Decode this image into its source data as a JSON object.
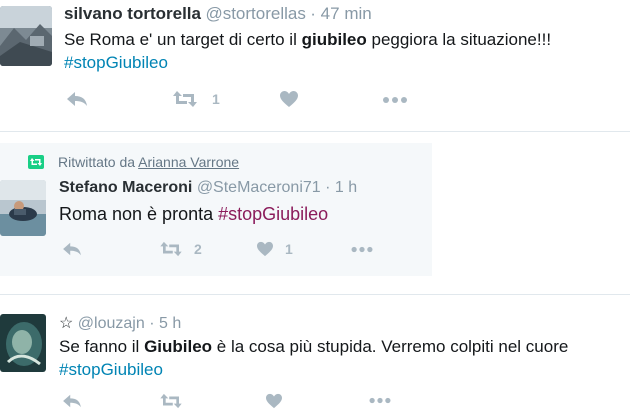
{
  "tweets": [
    {
      "name": "silvano tortorella",
      "handle": "@stortorellas",
      "time": "· 47 min",
      "text_pre": "Se Roma e' un target di certo il ",
      "text_bold": "giubileo",
      "text_post": " peggiora la situazione!!!",
      "hashtag": "#stopGiubileo",
      "retweet_count": "1",
      "like_count": ""
    },
    {
      "retweet_prefix": "Ritwittato da ",
      "retweeted_by": "Arianna Varrone",
      "name": "Stefano Maceroni",
      "handle": "@SteMaceroni71",
      "time": "· 1 h",
      "text_pre": "Roma non è pronta ",
      "hashtag": "#stopGiubileo",
      "retweet_count": "2",
      "like_count": "1"
    },
    {
      "star": "☆",
      "handle": "@louzajn",
      "time": "· 5 h",
      "text_pre": "Se fanno il ",
      "text_bold": "Giubileo",
      "text_post": " è la cosa più stupida. Verremo colpiti nel cuore",
      "hashtag": "#stopGiubileo"
    }
  ],
  "icons": {
    "reply": "reply-icon",
    "retweet": "retweet-icon",
    "like": "heart-icon",
    "more": "more-icon"
  }
}
